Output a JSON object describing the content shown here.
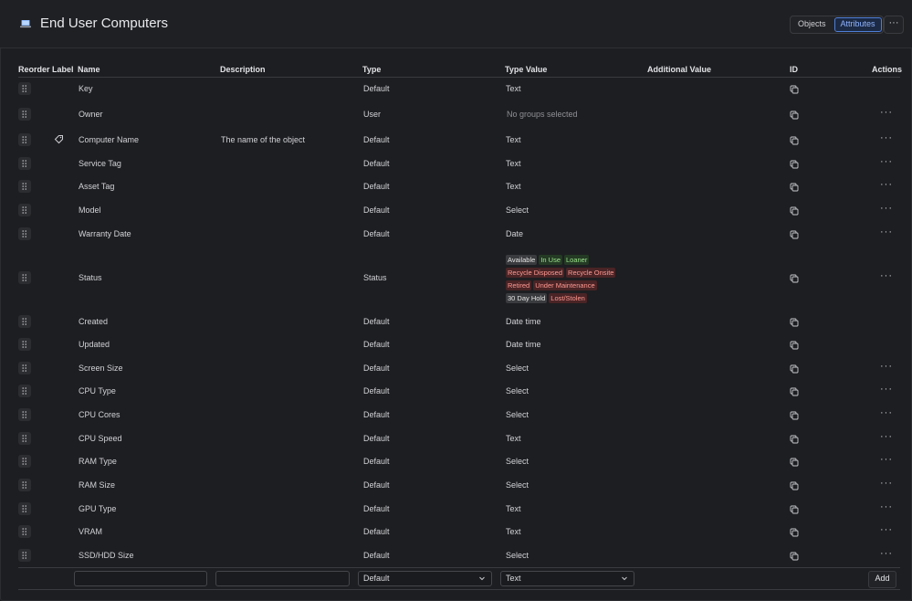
{
  "header": {
    "title": "End User Computers",
    "view_tabs": [
      {
        "label": "Objects",
        "active": false
      },
      {
        "label": "Attributes",
        "active": true
      }
    ],
    "more_label": "···"
  },
  "columns": {
    "reorder": "Reorder",
    "label": "Label",
    "name": "Name",
    "description": "Description",
    "type": "Type",
    "type_value": "Type Value",
    "additional_value": "Additional Value",
    "id": "ID",
    "actions": "Actions"
  },
  "rows": [
    {
      "name": "Key",
      "description": "",
      "type": "Default",
      "type_value": "Text",
      "muted": false,
      "label_icon": false,
      "actions": false
    },
    {
      "name": "Owner",
      "description": "",
      "type": "User",
      "type_value": "No groups selected",
      "muted": true,
      "label_icon": false,
      "actions": true
    },
    {
      "name": "Computer Name",
      "description": "The name of the object",
      "type": "Default",
      "type_value": "Text",
      "muted": false,
      "label_icon": true,
      "actions": true
    },
    {
      "name": "Service Tag",
      "description": "",
      "type": "Default",
      "type_value": "Text",
      "muted": false,
      "label_icon": false,
      "actions": true
    },
    {
      "name": "Asset Tag",
      "description": "",
      "type": "Default",
      "type_value": "Text",
      "muted": false,
      "label_icon": false,
      "actions": true
    },
    {
      "name": "Model",
      "description": "",
      "type": "Default",
      "type_value": "Select",
      "muted": false,
      "label_icon": false,
      "actions": true
    },
    {
      "name": "Warranty Date",
      "description": "",
      "type": "Default",
      "type_value": "Date",
      "muted": false,
      "label_icon": false,
      "actions": true
    },
    {
      "name": "Status",
      "description": "",
      "type": "Status",
      "type_value": "",
      "muted": false,
      "label_icon": false,
      "actions": true,
      "statuses": [
        [
          {
            "text": "Available",
            "color": "grey"
          },
          {
            "text": "In Use",
            "color": "green"
          },
          {
            "text": "Loaner",
            "color": "green"
          }
        ],
        [
          {
            "text": "Recycle Disposed",
            "color": "red"
          },
          {
            "text": "Recycle Onsite",
            "color": "red"
          }
        ],
        [
          {
            "text": "Retired",
            "color": "red"
          },
          {
            "text": "Under Maintenance",
            "color": "red"
          }
        ],
        [
          {
            "text": "30 Day Hold",
            "color": "grey"
          },
          {
            "text": "Lost/Stolen",
            "color": "red"
          }
        ]
      ]
    },
    {
      "name": "Created",
      "description": "",
      "type": "Default",
      "type_value": "Date time",
      "muted": false,
      "label_icon": false,
      "actions": false
    },
    {
      "name": "Updated",
      "description": "",
      "type": "Default",
      "type_value": "Date time",
      "muted": false,
      "label_icon": false,
      "actions": false
    },
    {
      "name": "Screen Size",
      "description": "",
      "type": "Default",
      "type_value": "Select",
      "muted": false,
      "label_icon": false,
      "actions": true
    },
    {
      "name": "CPU Type",
      "description": "",
      "type": "Default",
      "type_value": "Select",
      "muted": false,
      "label_icon": false,
      "actions": true
    },
    {
      "name": "CPU Cores",
      "description": "",
      "type": "Default",
      "type_value": "Select",
      "muted": false,
      "label_icon": false,
      "actions": true
    },
    {
      "name": "CPU Speed",
      "description": "",
      "type": "Default",
      "type_value": "Text",
      "muted": false,
      "label_icon": false,
      "actions": true
    },
    {
      "name": "RAM Type",
      "description": "",
      "type": "Default",
      "type_value": "Select",
      "muted": false,
      "label_icon": false,
      "actions": true
    },
    {
      "name": "RAM Size",
      "description": "",
      "type": "Default",
      "type_value": "Select",
      "muted": false,
      "label_icon": false,
      "actions": true
    },
    {
      "name": "GPU Type",
      "description": "",
      "type": "Default",
      "type_value": "Text",
      "muted": false,
      "label_icon": false,
      "actions": true
    },
    {
      "name": "VRAM",
      "description": "",
      "type": "Default",
      "type_value": "Text",
      "muted": false,
      "label_icon": false,
      "actions": true
    },
    {
      "name": "SSD/HDD Size",
      "description": "",
      "type": "Default",
      "type_value": "Select",
      "muted": false,
      "label_icon": false,
      "actions": true
    }
  ],
  "new_row": {
    "name_value": "",
    "description_value": "",
    "type_selected": "Default",
    "type_value_selected": "Text",
    "add_label": "Add"
  },
  "icons": {
    "title": "laptop-icon",
    "reorder": "drag-handle-icon",
    "label": "tag-icon",
    "id": "copy-icon",
    "actions": "more-icon",
    "select": "chevron-down-icon"
  },
  "colors": {
    "background": "#1d1e21",
    "accent": "#4f7ed8",
    "badge_green": "#9be38d",
    "badge_red": "#ff9a92"
  }
}
